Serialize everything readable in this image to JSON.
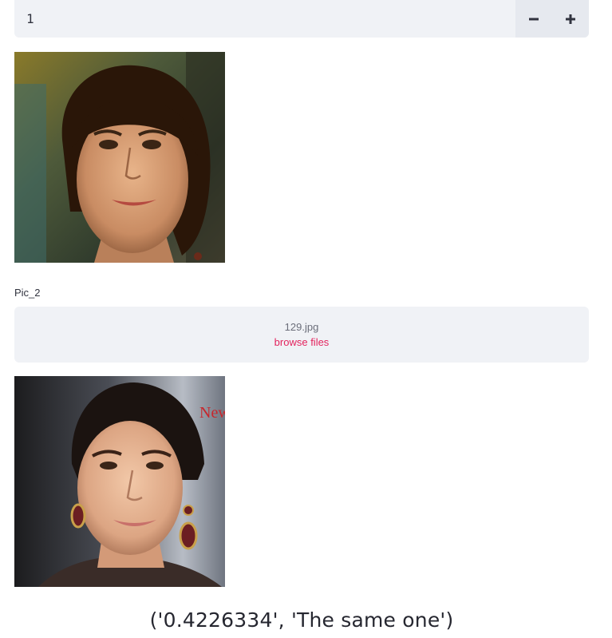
{
  "number_input": {
    "value": "1",
    "decrement_icon": "minus-icon",
    "increment_icon": "plus-icon"
  },
  "images": {
    "first": "portrait-photo-woman-short-brown-hair",
    "second": "portrait-photo-woman-hair-pulled-back-earrings"
  },
  "pic2": {
    "label": "Pic_2",
    "uploader": {
      "file_name": "129.jpg",
      "browse_label": "browse files"
    }
  },
  "result": {
    "text": "('0.4226334', 'The same one')"
  },
  "colors": {
    "input_bg": "#f0f2f6",
    "accent": "#e3245e",
    "text": "#262730"
  }
}
